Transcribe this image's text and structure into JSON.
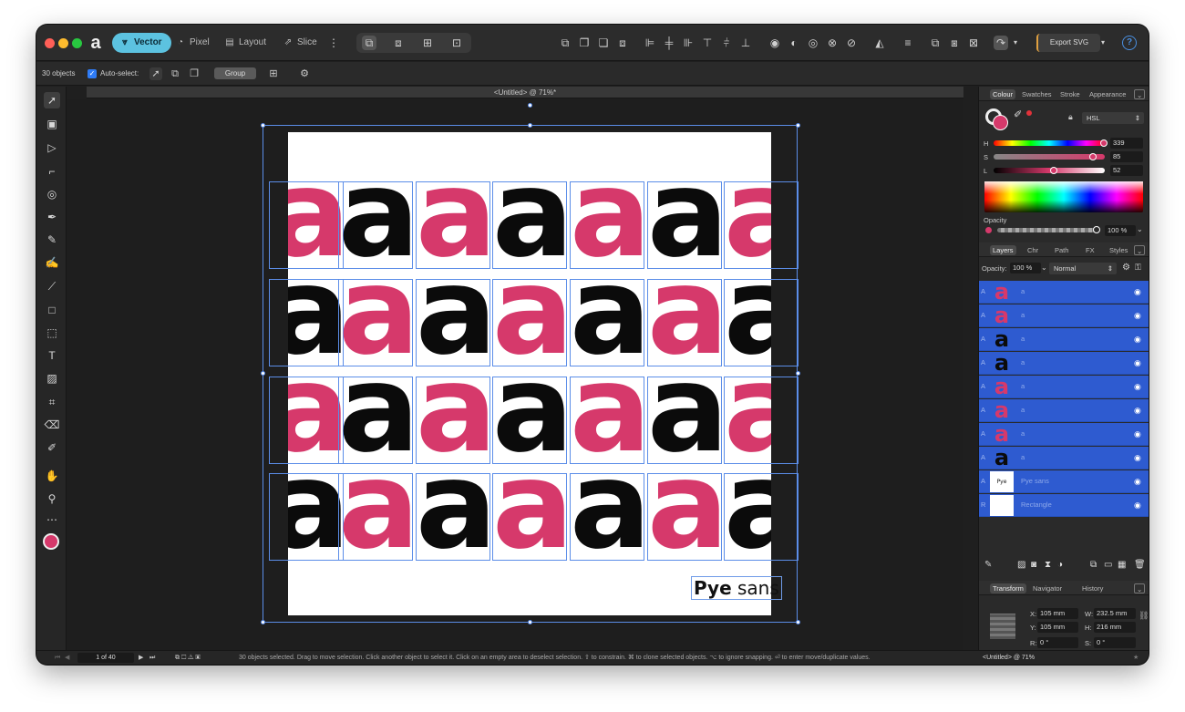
{
  "toolbar": {
    "personas": [
      "Vector",
      "Pixel",
      "Layout",
      "Slice"
    ],
    "export_label": "Export SVG",
    "help_icon": "help-icon"
  },
  "context": {
    "objects_count": "30 objects",
    "autoselect_label": "Auto-select:",
    "group_label": "Group"
  },
  "document": {
    "tab_title": "<Untitled> @ 71%*",
    "pattern_rows": [
      [
        "pink",
        "black",
        "pink",
        "black",
        "pink",
        "black",
        "pink"
      ],
      [
        "black",
        "pink",
        "black",
        "pink",
        "black",
        "pink",
        "black"
      ],
      [
        "pink",
        "black",
        "pink",
        "black",
        "pink",
        "black",
        "pink"
      ],
      [
        "black",
        "pink",
        "black",
        "pink",
        "black",
        "pink",
        "black"
      ]
    ],
    "glyph_char": "a",
    "label_bold": "Pye",
    "label_light": " sans"
  },
  "colour_panel": {
    "tabs": [
      "Colour",
      "Swatches",
      "Stroke",
      "Appearance"
    ],
    "model": "HSL",
    "h_label": "H",
    "h_value": "339",
    "s_label": "S",
    "s_value": "85",
    "l_label": "L",
    "l_value": "52",
    "opacity_label": "Opacity",
    "opacity_value": "100 %"
  },
  "layers_panel": {
    "tabs": [
      "Layers",
      "Chr",
      "Path",
      "FX",
      "Styles"
    ],
    "opacity_label": "Opacity:",
    "opacity_value": "100 %",
    "blend_mode": "Normal",
    "rows": [
      {
        "type": "A",
        "thumb": "pink",
        "name": "a"
      },
      {
        "type": "A",
        "thumb": "pink",
        "name": "a"
      },
      {
        "type": "A",
        "thumb": "black",
        "name": "a"
      },
      {
        "type": "A",
        "thumb": "black",
        "name": "a"
      },
      {
        "type": "A",
        "thumb": "pink",
        "name": "a"
      },
      {
        "type": "A",
        "thumb": "pink",
        "name": "a"
      },
      {
        "type": "A",
        "thumb": "pink",
        "name": "a"
      },
      {
        "type": "A",
        "thumb": "black",
        "name": "a"
      },
      {
        "type": "A",
        "thumb": "text",
        "name": "Pye sans"
      },
      {
        "type": "R",
        "thumb": "white",
        "name": "Rectangle"
      }
    ]
  },
  "transform_panel": {
    "tabs": [
      "Transform",
      "Navigator",
      "History"
    ],
    "x_label": "X:",
    "x_value": "105 mm",
    "y_label": "Y:",
    "y_value": "105 mm",
    "w_label": "W:",
    "w_value": "232.5 mm",
    "h_label": "H:",
    "h_value": "216 mm",
    "r_label": "R:",
    "r_value": "0 °",
    "s_label": "S:",
    "s_value": "0 °"
  },
  "statusbar": {
    "page_indicator": "1 of 40",
    "hint": "30 objects selected. Drag to move selection. Click another object to select it. Click on an empty area to deselect selection. ⇧ to constrain. ⌘ to clone selected objects. ⌥ to ignore snapping. ⏎ to enter move/duplicate values.",
    "doc_name": "<Untitled> @ 71%"
  },
  "colors": {
    "accent_pink": "#d6396b",
    "persona_active": "#5cc2e0",
    "selection_blue": "#2e5bd0"
  }
}
